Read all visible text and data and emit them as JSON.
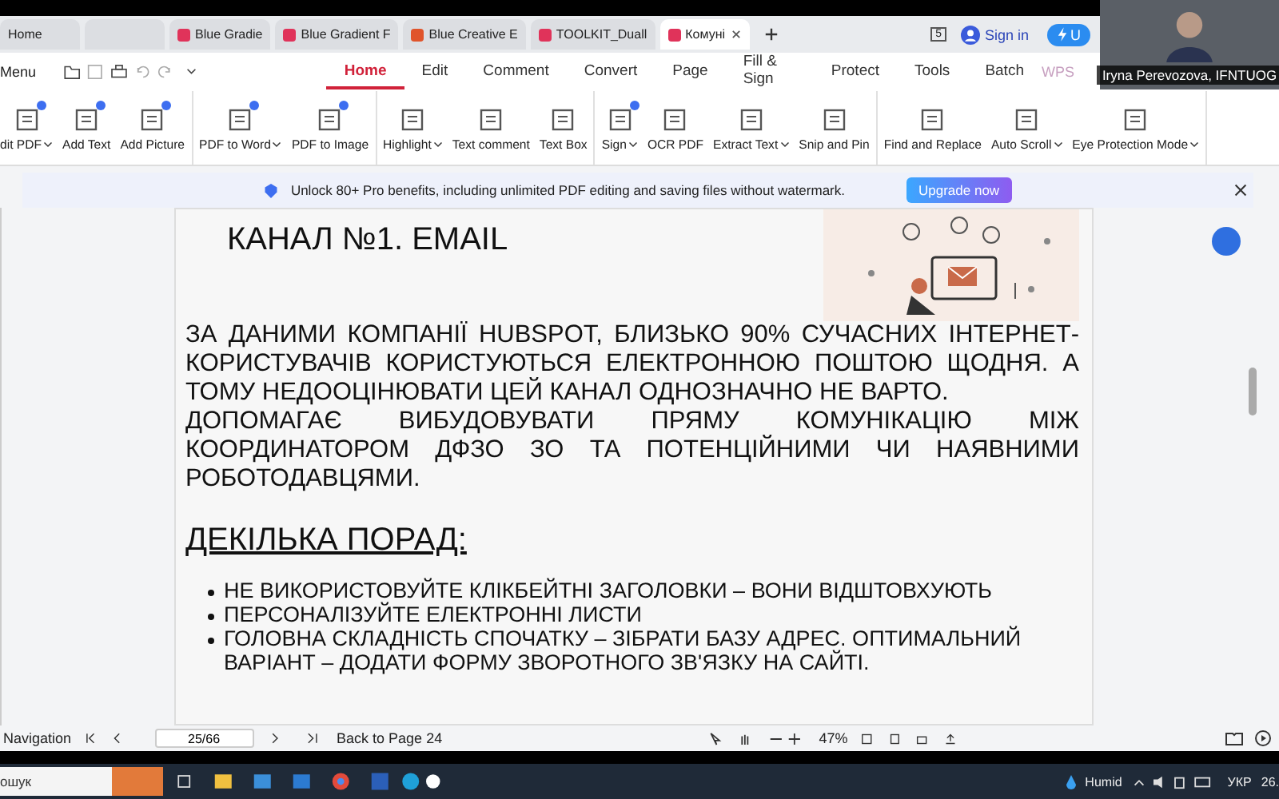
{
  "browser_tabs": [
    {
      "label": "Home",
      "selected": false
    },
    {
      "selected": false
    },
    {
      "label": "Blue Gradie",
      "selected": false,
      "color": "#e0335a"
    },
    {
      "label": "Blue Gradient F",
      "selected": false,
      "color": "#e0335a"
    },
    {
      "label": "Blue Creative E",
      "selected": false,
      "color": "#e0542b"
    },
    {
      "label": "TOOLKIT_Duall",
      "selected": false,
      "color": "#e0335a"
    },
    {
      "label": "Комуні",
      "selected": true,
      "color": "#e0335a"
    }
  ],
  "account": {
    "badge": "5",
    "sign_in": "Sign in",
    "upgrade": "U"
  },
  "menu": {
    "label": "Menu",
    "tabs": [
      {
        "label": "Home",
        "selected": true
      },
      {
        "label": "Edit",
        "selected": false
      },
      {
        "label": "Comment",
        "selected": false
      },
      {
        "label": "Convert",
        "selected": false
      },
      {
        "label": "Page",
        "selected": false
      },
      {
        "label": "Fill & Sign",
        "selected": false
      },
      {
        "label": "Protect",
        "selected": false
      },
      {
        "label": "Tools",
        "selected": false
      },
      {
        "label": "Batch",
        "selected": false
      }
    ],
    "wps": "WPS"
  },
  "toolbar": [
    [
      {
        "label": "dit PDF",
        "dropdown": true,
        "pro": true
      },
      {
        "label": "Add Text",
        "dropdown": false,
        "pro": true
      },
      {
        "label": "Add Picture",
        "dropdown": false,
        "pro": true
      }
    ],
    [
      {
        "label": "PDF to Word",
        "dropdown": true,
        "pro": true
      },
      {
        "label": "PDF to Image",
        "dropdown": false,
        "pro": true
      }
    ],
    [
      {
        "label": "Highlight",
        "dropdown": true,
        "pro": false
      },
      {
        "label": "Text comment",
        "dropdown": false,
        "pro": false
      },
      {
        "label": "Text Box",
        "dropdown": false,
        "pro": false
      }
    ],
    [
      {
        "label": "Sign",
        "dropdown": true,
        "pro": true
      },
      {
        "label": "OCR PDF",
        "dropdown": false,
        "pro": false
      },
      {
        "label": "Extract Text",
        "dropdown": true,
        "pro": false
      },
      {
        "label": "Snip and Pin",
        "dropdown": false,
        "pro": false
      }
    ],
    [
      {
        "label": "Find and Replace",
        "dropdown": false,
        "pro": false
      },
      {
        "label": "Auto Scroll",
        "dropdown": true,
        "pro": false
      },
      {
        "label": "Eye Protection Mode",
        "dropdown": true,
        "pro": false
      }
    ]
  ],
  "banner": {
    "text": "Unlock 80+ Pro benefits, including unlimited PDF editing and saving files without watermark.",
    "button": "Upgrade now"
  },
  "document": {
    "title": "КАНАЛ №1. EMAIL",
    "paragraphs": [
      "ЗА ДАНИМИ КОМПАНІЇ HUBSPOT, БЛИЗЬКО 90% СУЧАСНИХ ІНТЕРНЕТ-КОРИСТУВАЧІВ КОРИСТУЮТЬСЯ ЕЛЕКТРОННОЮ ПОШТОЮ ЩОДНЯ. А ТОМУ НЕДООЦІНЮВАТИ ЦЕЙ КАНАЛ ОДНОЗНАЧНО НЕ ВАРТО.",
      "ДОПОМАГАЄ ВИБУДОВУВАТИ ПРЯМУ КОМУНІКАЦІЮ МІЖ КООРДИНАТОРОМ ДФЗО ЗО ТА ПОТЕНЦІЙНИМИ ЧИ НАЯВНИМИ РОБОТОДАВЦЯМИ."
    ],
    "subtitle": "ДЕКІЛЬКА ПОРАД:",
    "bullets": [
      "НЕ ВИКОРИСТОВУЙТЕ КЛІКБЕЙТНІ ЗАГОЛОВКИ – ВОНИ ВІДШТОВХУЮТЬ",
      "ПЕРСОНАЛІЗУЙТЕ ЕЛЕКТРОННІ ЛИСТИ",
      "ГОЛОВНА СКЛАДНІСТЬ СПОЧАТКУ – ЗІБРАТИ БАЗУ АДРЕС. ОПТИМАЛЬНИЙ ВАРІАНТ – ДОДАТИ ФОРМУ ЗВОРОТНОГО ЗВ'ЯЗКУ НА САЙТІ."
    ]
  },
  "status_bar": {
    "navigation": "Navigation",
    "page": "25/66",
    "back": "Back to Page 24",
    "zoom": "47%"
  },
  "taskbar": {
    "search": "ошук",
    "weather": "Humid",
    "language": "УКР",
    "clock": "26."
  },
  "video": {
    "caption": "Iryna Perevozova, IFNTUOG"
  }
}
